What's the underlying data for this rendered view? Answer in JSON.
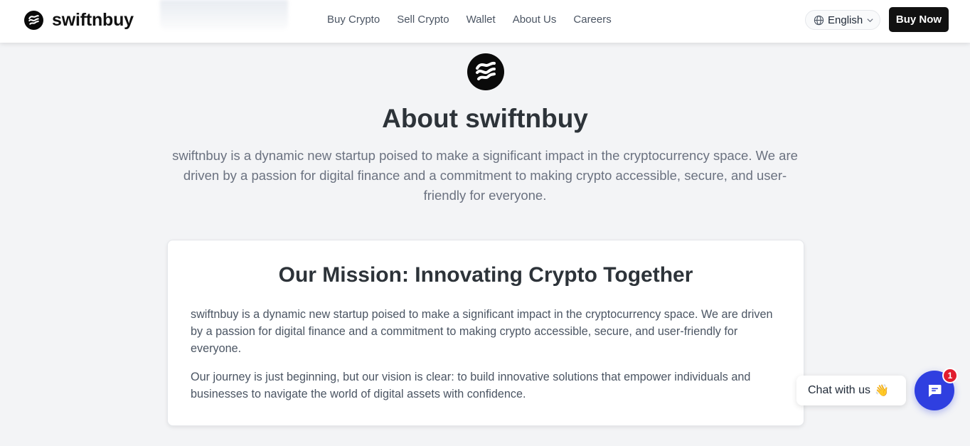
{
  "header": {
    "brand": "swiftnbuy",
    "nav": [
      "Buy Crypto",
      "Sell Crypto",
      "Wallet",
      "About Us",
      "Careers"
    ],
    "language": "English",
    "cta": "Buy Now"
  },
  "hero": {
    "title": "About swiftnbuy",
    "description": "swiftnbuy is a dynamic new startup poised to make a significant impact in the cryptocurrency space. We are driven by a passion for digital finance and a commitment to making crypto accessible, secure, and user-friendly for everyone."
  },
  "mission": {
    "title": "Our Mission: Innovating Crypto Together",
    "paragraph1": "swiftnbuy is a dynamic new startup poised to make a significant impact in the cryptocurrency space. We are driven by a passion for digital finance and a commitment to making crypto accessible, secure, and user-friendly for everyone.",
    "paragraph2": "Our journey is just beginning, but our vision is clear: to build innovative solutions that empower individuals and businesses to navigate the world of digital assets with confidence."
  },
  "chat": {
    "label": "Chat with us",
    "emoji": "👋",
    "badge": "1"
  },
  "colors": {
    "accent": "#2f3fe0",
    "badge": "#e11d2e",
    "dark": "#111111"
  }
}
